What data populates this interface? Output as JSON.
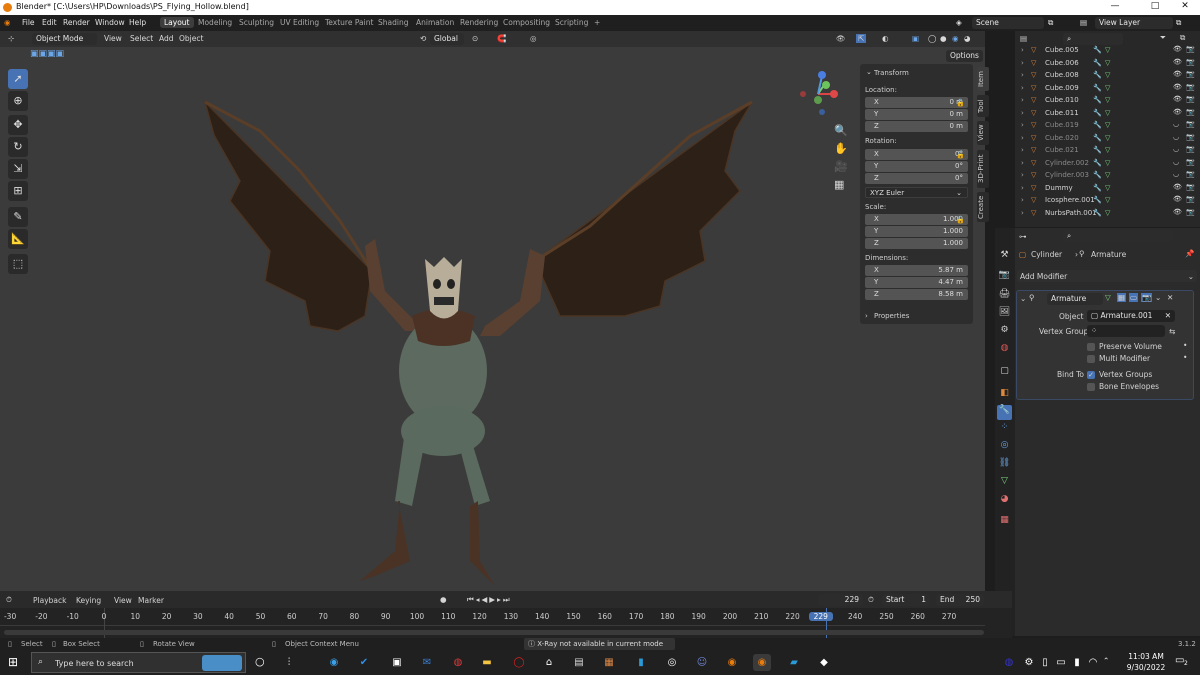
{
  "window": {
    "title": "Blender* [C:\\Users\\HP\\Downloads\\PS_Flying_Hollow.blend]",
    "minimize": "—",
    "maximize": "□",
    "close": "✕"
  },
  "menu": [
    "File",
    "Edit",
    "Render",
    "Window",
    "Help"
  ],
  "workspaces": [
    "Layout",
    "Modeling",
    "Sculpting",
    "UV Editing",
    "Texture Paint",
    "Shading",
    "Animation",
    "Rendering",
    "Compositing",
    "Scripting",
    "+"
  ],
  "scene": {
    "label": "Scene",
    "view_layer": "View Layer"
  },
  "viewport_header": {
    "mode": "Object Mode",
    "menus": [
      "View",
      "Select",
      "Add",
      "Object"
    ],
    "orientation": "Global",
    "options": "Options"
  },
  "npanel": {
    "section": "Transform",
    "location_label": "Location:",
    "location": [
      {
        "axis": "X",
        "value": "0 m"
      },
      {
        "axis": "Y",
        "value": "0 m"
      },
      {
        "axis": "Z",
        "value": "0 m"
      }
    ],
    "rotation_label": "Rotation:",
    "rotation": [
      {
        "axis": "X",
        "value": "0°"
      },
      {
        "axis": "Y",
        "value": "0°"
      },
      {
        "axis": "Z",
        "value": "0°"
      }
    ],
    "rotation_mode": "XYZ Euler",
    "scale_label": "Scale:",
    "scale": [
      {
        "axis": "X",
        "value": "1.000"
      },
      {
        "axis": "Y",
        "value": "1.000"
      },
      {
        "axis": "Z",
        "value": "1.000"
      }
    ],
    "dimensions_label": "Dimensions:",
    "dimensions": [
      {
        "axis": "X",
        "value": "5.87 m"
      },
      {
        "axis": "Y",
        "value": "4.47 m"
      },
      {
        "axis": "Z",
        "value": "8.58 m"
      }
    ],
    "properties": "Properties",
    "tabs": [
      "Item",
      "Tool",
      "View",
      "3D-Print",
      "Create"
    ]
  },
  "outliner": {
    "rows": [
      "Cube.005",
      "Cube.006",
      "Cube.008",
      "Cube.009",
      "Cube.010",
      "Cube.011",
      "Cube.019",
      "Cube.020",
      "Cube.021",
      "Cylinder.002",
      "Cylinder.003",
      "Dummy",
      "Icosphere.001",
      "NurbsPath.001"
    ]
  },
  "properties": {
    "object": "Cylinder",
    "modifier_target": "Armature",
    "add_modifier": "Add Modifier",
    "modifier_name": "Armature",
    "object_label": "Object",
    "object_value": "Armature.001",
    "vertex_group_label": "Vertex Group",
    "preserve_volume": "Preserve Volume",
    "multi_modifier": "Multi Modifier",
    "bind_to_label": "Bind To",
    "vertex_groups": "Vertex Groups",
    "bone_envelopes": "Bone Envelopes"
  },
  "timeline": {
    "menus": [
      "Playback",
      "Keying",
      "View",
      "Marker"
    ],
    "current_frame": "229",
    "start_label": "Start",
    "start": "1",
    "end_label": "End",
    "end": "250",
    "ticks": [
      "-30",
      "-20",
      "-10",
      "0",
      "10",
      "20",
      "30",
      "40",
      "50",
      "60",
      "70",
      "80",
      "90",
      "100",
      "110",
      "120",
      "130",
      "140",
      "150",
      "160",
      "170",
      "180",
      "190",
      "200",
      "210",
      "220",
      "229",
      "240",
      "250",
      "260",
      "270"
    ]
  },
  "status": {
    "select": "Select",
    "box_select": "Box Select",
    "rotate_view": "Rotate View",
    "context_menu": "Object Context Menu",
    "message": "X-Ray not available in current mode",
    "version": "3.1.2"
  },
  "taskbar": {
    "search": "Type here to search",
    "time": "11:03 AM",
    "date": "9/30/2022",
    "notifications": "2"
  },
  "colors": {
    "accent": "#4772b3",
    "object_orange": "#e0883a",
    "viewport_bg": "#3b3b3b"
  }
}
